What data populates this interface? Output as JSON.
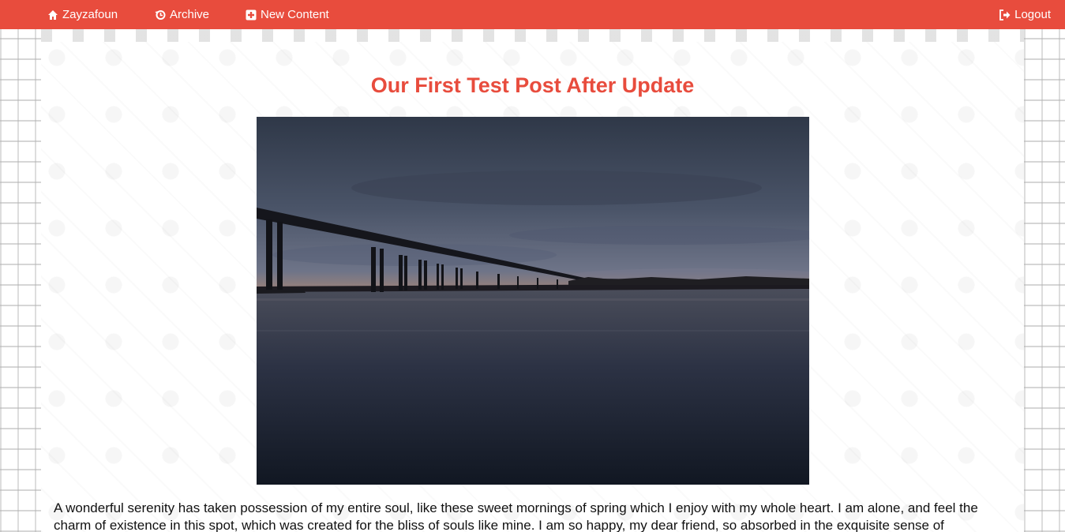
{
  "navbar": {
    "home_label": "Zayzafoun",
    "archive_label": "Archive",
    "new_content_label": "New Content",
    "logout_label": "Logout",
    "accent_color": "#e84c3d"
  },
  "icons": {
    "home": "home-icon",
    "archive": "history-icon",
    "new_content": "plus-square-icon",
    "logout": "sign-out-icon"
  },
  "post": {
    "title": "Our First Test Post After Update",
    "image_subject": "bridge-at-sunset-over-water",
    "body": "A wonderful serenity has taken possession of my entire soul, like these sweet mornings of spring which I enjoy with my whole heart. I am alone, and feel the charm of existence in this spot, which was created for the bliss of souls like mine. I am so happy, my dear friend, so absorbed in the exquisite sense of"
  }
}
